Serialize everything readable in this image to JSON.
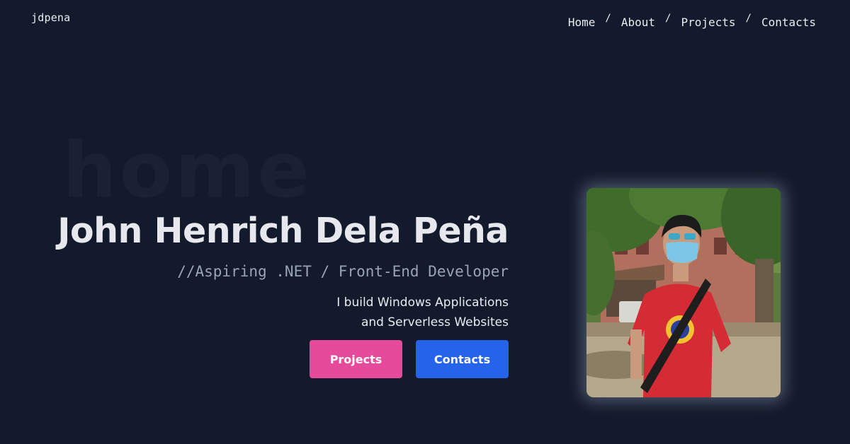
{
  "brand": {
    "logo": "jdpena"
  },
  "nav": {
    "items": [
      "Home",
      "About",
      "Projects",
      "Contacts"
    ],
    "separator": "/"
  },
  "hero": {
    "watermark": "home",
    "name": "John Henrich Dela Peña",
    "tagline": "//Aspiring .NET / Front-End Developer",
    "description_line1": "I build Windows Applications",
    "description_line2": "and Serverless Websites",
    "buttons": {
      "projects_label": "Projects",
      "contacts_label": "Contacts"
    }
  },
  "colors": {
    "background": "#131a2b",
    "projects_button": "#e64a9a",
    "contacts_button": "#2563eb",
    "text": "#e8ebf2",
    "muted_text": "#9aa3b4"
  }
}
